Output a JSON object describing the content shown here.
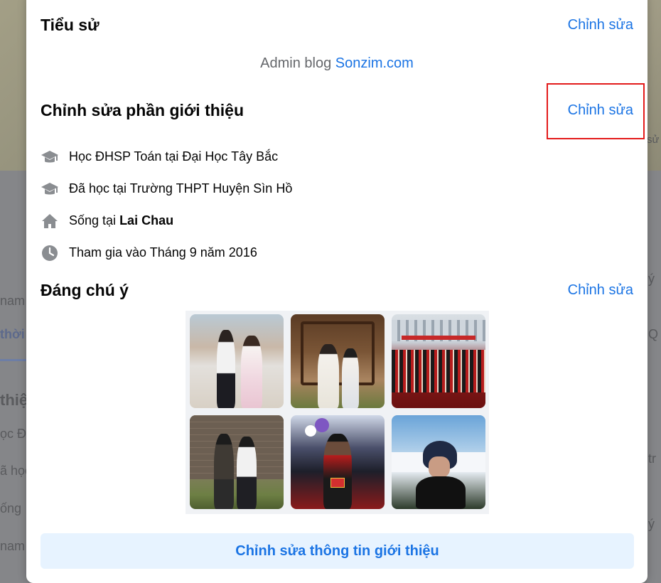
{
  "background": {
    "fragments": [
      "nam",
      "thời",
      "thiệ",
      "ọc Đ",
      "ã học",
      "ống",
      "nam",
      "ý",
      "Q",
      "tr",
      "ý",
      "sử"
    ]
  },
  "sections": {
    "bio": {
      "title": "Tiểu sử",
      "edit_label": "Chỉnh sửa",
      "text_prefix": "Admin blog ",
      "text_link": "Sonzim.com"
    },
    "intro": {
      "title": "Chỉnh sửa phần giới thiệu",
      "edit_label": "Chỉnh sửa"
    },
    "featured": {
      "title": "Đáng chú ý",
      "edit_label": "Chỉnh sửa"
    }
  },
  "info_items": [
    {
      "icon": "graduation-cap-icon",
      "text": "Học ĐHSP Toán tại Đại Học Tây Bắc"
    },
    {
      "icon": "graduation-cap-icon",
      "text": "Đã học tại Trường THPT Huyện Sìn Hồ"
    },
    {
      "icon": "home-icon",
      "prefix": "Sống tại ",
      "bold": "Lai Chau"
    },
    {
      "icon": "clock-icon",
      "text": "Tham gia vào Tháng 9 năm 2016"
    }
  ],
  "photos": [
    {
      "name": "featured-photo-couple-outdoor"
    },
    {
      "name": "featured-photo-couple-gate"
    },
    {
      "name": "featured-photo-graduation-group"
    },
    {
      "name": "featured-photo-two-men"
    },
    {
      "name": "featured-photo-graduate-balloons"
    },
    {
      "name": "featured-photo-man-helmet"
    }
  ],
  "footer": {
    "edit_intro_label": "Chỉnh sửa thông tin giới thiệu"
  },
  "colors": {
    "link": "#1b74e4",
    "highlight": "#e31b1b",
    "button_bg": "#e7f3ff"
  }
}
